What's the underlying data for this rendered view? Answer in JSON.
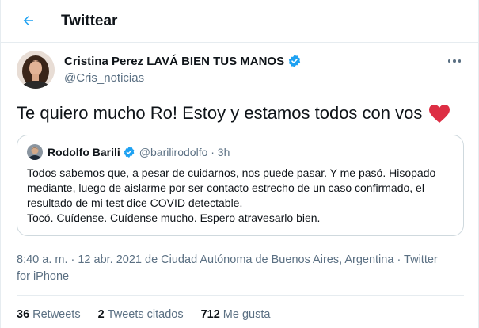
{
  "header": {
    "title": "Twittear"
  },
  "tweet": {
    "author_name": "Cristina Perez LAVÁ BIEN TUS MANOS",
    "author_handle": "@Cris_noticias",
    "text": "Te quiero mucho Ro! Estoy y estamos todos con vos",
    "quote": {
      "author_name": "Rodolfo Barili",
      "meta": "@barilirodolfo · 3h",
      "lines": [
        "Todos sabemos que, a pesar de cuidarnos, nos puede pasar. Y me pasó. Hisopado",
        "mediante, luego de aislarme por ser contacto estrecho de un caso confirmado, el",
        "resultado de mi test dice COVID detectable.",
        "Tocó. Cuídense. Cuídense mucho. Espero atravesarlo bien."
      ]
    },
    "meta_lines": [
      "8:40 a. m. · 12 abr. 2021 de Ciudad Autónoma de Buenos Aires, Argentina · Twitter",
      "for iPhone"
    ],
    "stats": {
      "retweets_count": "36",
      "retweets_label": "Retweets",
      "quotes_count": "2",
      "quotes_label": "Tweets citados",
      "likes_count": "712",
      "likes_label": "Me gusta"
    }
  },
  "colors": {
    "accent": "#1da1f2",
    "secondary_text": "#5b7083",
    "heart": "#e0245e",
    "border": "#cfd9de"
  },
  "icons": [
    "back-arrow-icon",
    "verified-badge-icon",
    "more-options-icon",
    "red-heart-emoji-icon"
  ]
}
